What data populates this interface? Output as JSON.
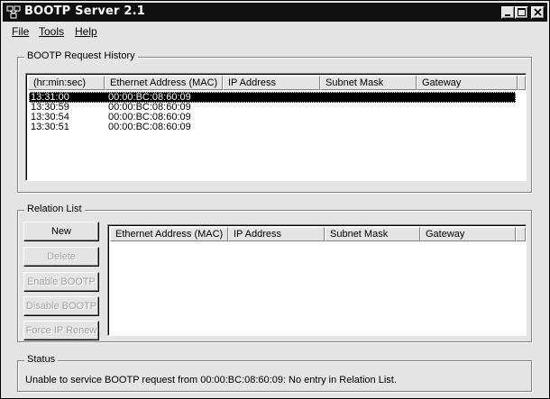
{
  "window": {
    "title": "BOOTP Server 2.1"
  },
  "menu": {
    "file_label": "File",
    "tools_label": "Tools",
    "help_label": "Help"
  },
  "history": {
    "group_label": "BOOTP Request History",
    "columns": [
      "(hr:min:sec)",
      "Ethernet Address (MAC)",
      "IP Address",
      "Subnet Mask",
      "Gateway"
    ],
    "rows": [
      {
        "time": "13:31:00",
        "mac": "00:00:BC:08:60:09",
        "selected": true
      },
      {
        "time": "13:30:59",
        "mac": "00:00:BC:08:60:09",
        "selected": false
      },
      {
        "time": "13:30:54",
        "mac": "00:00:BC:08:60:09",
        "selected": false
      },
      {
        "time": "13:30:51",
        "mac": "00:00:BC:08:60:09",
        "selected": false
      }
    ]
  },
  "relation": {
    "group_label": "Relation List",
    "columns": [
      "Ethernet Address (MAC)",
      "IP Address",
      "Subnet Mask",
      "Gateway"
    ],
    "buttons": {
      "new": "New",
      "delete": "Delete",
      "enable": "Enable BOOTP",
      "disable": "Disable BOOTP",
      "force": "Force IP Renew"
    }
  },
  "status": {
    "group_label": "Status",
    "message": "Unable to service BOOTP request from 00:00:BC:08:60:09:  No entry in Relation List."
  },
  "icons": {
    "app": "network-icon",
    "minimize": "minimize-icon",
    "maximize": "maximize-icon",
    "close": "close-icon"
  }
}
